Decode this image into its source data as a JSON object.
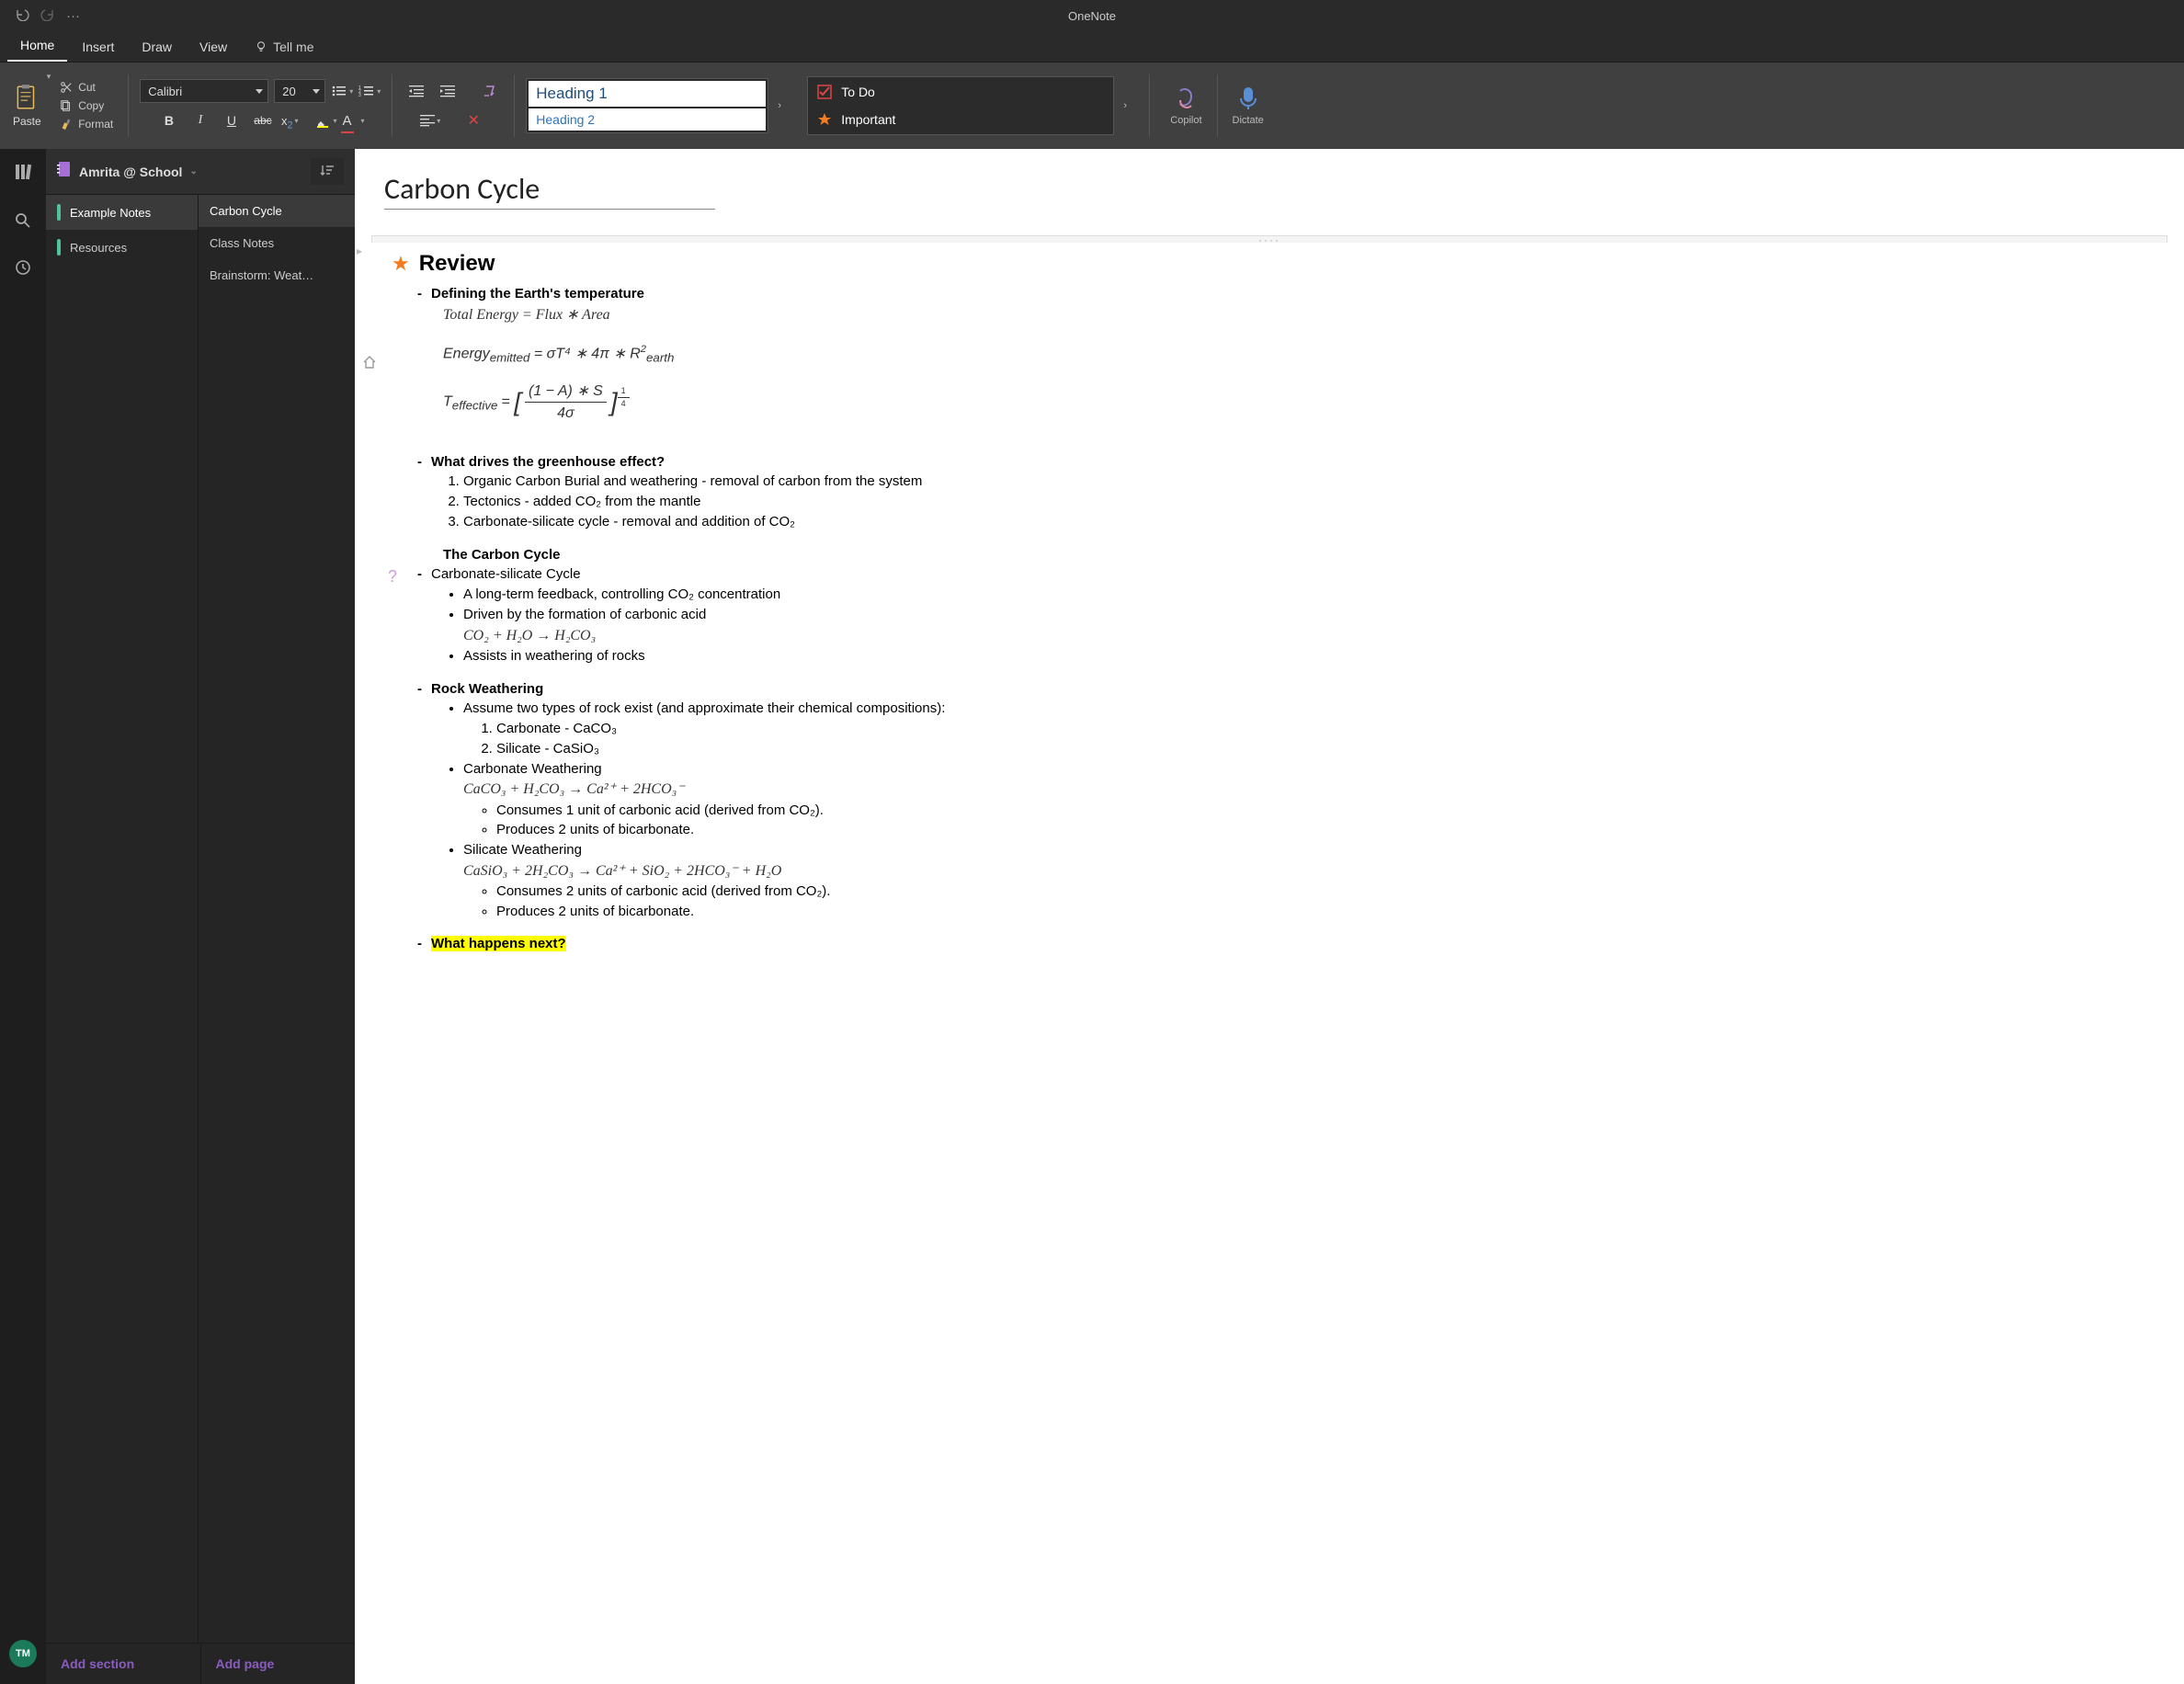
{
  "app": {
    "title": "OneNote"
  },
  "titlebar": {
    "undo": "↶",
    "redo": "↷",
    "more": "···"
  },
  "tabs": {
    "items": [
      "Home",
      "Insert",
      "Draw",
      "View"
    ],
    "active": "Home",
    "tell_me": "Tell me"
  },
  "ribbon": {
    "paste": "Paste",
    "cut": "Cut",
    "copy": "Copy",
    "format": "Format",
    "font_name": "Calibri",
    "font_size": "20",
    "styles": {
      "h1": "Heading 1",
      "h2": "Heading 2"
    },
    "tags": {
      "todo": "To Do",
      "important": "Important"
    },
    "copilot": "Copilot",
    "dictate": "Dictate"
  },
  "nav": {
    "notebook": "Amrita @ School",
    "sections": [
      {
        "name": "Example Notes",
        "active": true
      },
      {
        "name": "Resources",
        "active": false
      }
    ],
    "pages": [
      {
        "name": "Carbon Cycle",
        "active": true
      },
      {
        "name": "Class Notes",
        "active": false
      },
      {
        "name": "Brainstorm: Weat…",
        "active": false
      }
    ],
    "add_section": "Add section",
    "add_page": "Add page"
  },
  "avatar": "TM",
  "page": {
    "title": "Carbon Cycle",
    "review": "Review",
    "def_temp": "Defining the Earth's temperature",
    "eq1": "Total Energy = Flux ∗ Area",
    "eq2_lhs": "Energy",
    "eq2_sub": "emitted",
    "eq2_rhs": " = σT⁴ ∗ 4π ∗ R",
    "eq2_rhs2": "earth",
    "eq3_lhs": "T",
    "eq3_sub": "effective",
    "eq3_num": "(1 − A) ∗ S",
    "eq3_den": "4σ",
    "greenhouse_q": "What drives the greenhouse effect?",
    "gh1": "Organic Carbon Burial and weathering - removal of carbon from the system",
    "gh2": "Tectonics - added CO₂ from the mantle",
    "gh3": "Carbonate-silicate cycle - removal and addition of CO₂",
    "cc_title": "The Carbon Cycle",
    "csc": "Carbonate-silicate Cycle",
    "csc_b1": "A long-term feedback, controlling CO₂ concentration",
    "csc_b2": "Driven by the formation of carbonic acid",
    "eq_carbonic": "CO₂ + H₂O → H₂CO₃",
    "csc_b3": "Assists in weathering of rocks",
    "rock_w": "Rock Weathering",
    "rw_b1": "Assume two types of rock exist (and approximate their chemical compositions):",
    "rw_n1": "Carbonate - CaCO₃",
    "rw_n2": "Silicate - CaSiO₃",
    "carb_w": "Carbonate Weathering",
    "eq_carbw": "CaCO₃ + H₂CO₃ → Ca²⁺ + 2HCO₃⁻",
    "cw_o1": "Consumes 1 unit of carbonic acid (derived from CO₂).",
    "cw_o2": "Produces 2 units of bicarbonate.",
    "sil_w": "Silicate Weathering",
    "eq_silw": "CaSiO₃ + 2H₂CO₃ → Ca²⁺ + SiO₂ + 2HCO₃⁻ + H₂O",
    "sw_o1": "Consumes 2 units of carbonic acid (derived from CO₂).",
    "sw_o2": "Produces 2 units of bicarbonate.",
    "next_q": "What happens next?"
  }
}
